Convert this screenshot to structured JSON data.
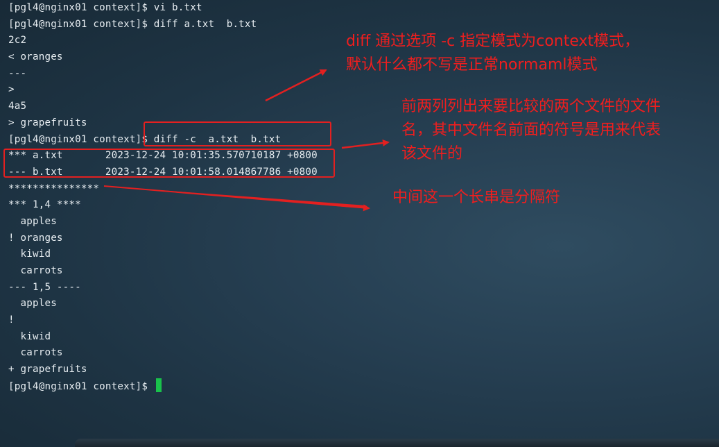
{
  "terminal": {
    "lines": [
      "[pgl4@nginx01 context]$ vi b.txt",
      "[pgl4@nginx01 context]$ diff a.txt  b.txt",
      "2c2",
      "< oranges",
      "---",
      ">",
      "4a5",
      "> grapefruits",
      "[pgl4@nginx01 context]$ diff -c  a.txt  b.txt",
      "*** a.txt       2023-12-24 10:01:35.570710187 +0800",
      "--- b.txt       2023-12-24 10:01:58.014867786 +0800",
      "***************",
      "*** 1,4 ****",
      "  apples",
      "! oranges",
      "  kiwid",
      "  carrots",
      "--- 1,5 ----",
      "  apples",
      "!",
      "  kiwid",
      "  carrots",
      "+ grapefruits"
    ],
    "prompt": "[pgl4@nginx01 context]$ "
  },
  "annotations": {
    "mode_note": "diff 通过选项 -c 指定模式为context模式，\n默认什么都不写是正常normaml模式",
    "header_note": "前两列列出来要比较的两个文件的文件\n名，其中文件名前面的符号是用来代表\n该文件的",
    "separator_note": "中间这一个长串是分隔符"
  },
  "colors": {
    "annotation": "#f01e1e",
    "cursor": "#19c24b",
    "text": "#e8eef2"
  }
}
